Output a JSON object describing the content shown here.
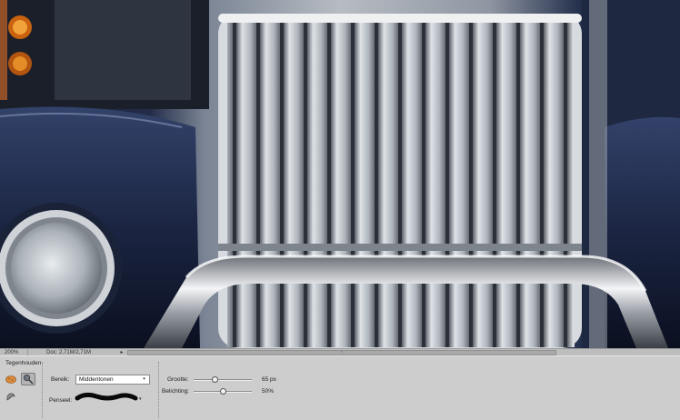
{
  "statusbar": {
    "zoom": "200%",
    "doc_info": "Doc: 2,71M/2,71M",
    "doc_arrow": "▸",
    "scroll_grip": "::"
  },
  "options": {
    "tool_name": "Tegenhouden",
    "range": {
      "label": "Bereik:",
      "value": "Middentonen",
      "arrow": "▾"
    },
    "brush": {
      "label": "Penseel:",
      "arrow": "▾"
    },
    "size": {
      "label": "Grootte:",
      "value": "65 px",
      "level": 0.35
    },
    "exposure": {
      "label": "Belichting:",
      "value": "50%",
      "level": 0.5
    }
  },
  "icons": {
    "sponge": "sponge-icon",
    "dodge": "dodge-icon",
    "burn": "burn-icon"
  },
  "colors": {
    "panel": "#cdcdcd",
    "statusbar": "#bdbdbd",
    "truck_paint": "#1f2a47",
    "chrome": "#c8ccd2"
  }
}
